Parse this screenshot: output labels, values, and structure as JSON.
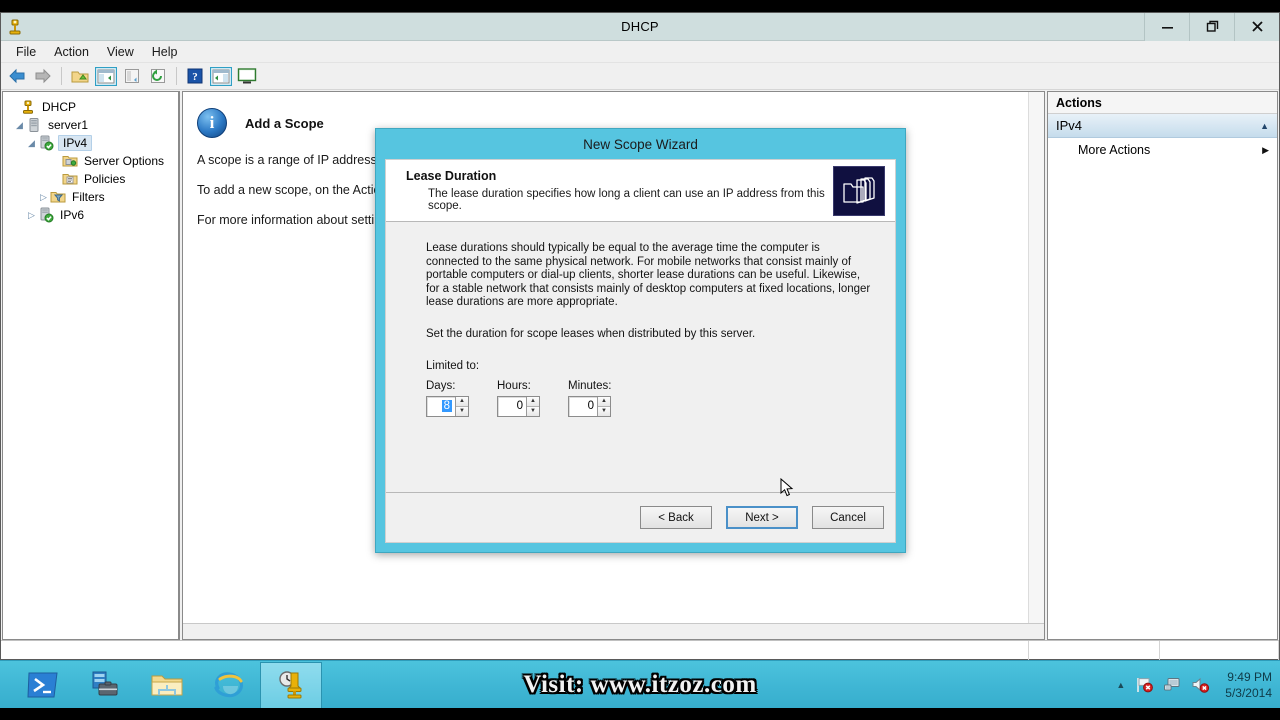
{
  "window": {
    "title": "DHCP",
    "icon": "dhcp-icon",
    "controls": {
      "minimize": "–",
      "restore": "❐",
      "close": "✕"
    }
  },
  "menubar": {
    "items": [
      "File",
      "Action",
      "View",
      "Help"
    ]
  },
  "toolbar": {
    "buttons": [
      {
        "name": "back-icon"
      },
      {
        "name": "forward-icon"
      },
      {
        "name": "up-folder-icon"
      },
      {
        "name": "show-hide-console-tree-icon"
      },
      {
        "name": "properties-icon"
      },
      {
        "name": "refresh-icon"
      },
      {
        "name": "help-icon"
      },
      {
        "name": "show-hide-action-pane-icon"
      },
      {
        "name": "export-list-icon"
      }
    ]
  },
  "tree": {
    "nodes": [
      {
        "label": "DHCP",
        "indent": 0,
        "expander": "",
        "icon": "dhcp-root-icon",
        "selected": false
      },
      {
        "label": "server1",
        "indent": 1,
        "expander": "◢",
        "icon": "server-icon",
        "selected": false
      },
      {
        "label": "IPv4",
        "indent": 2,
        "expander": "◢",
        "icon": "ipv4-ok-icon",
        "selected": true
      },
      {
        "label": "Server Options",
        "indent": 4,
        "expander": "",
        "icon": "server-options-folder-icon",
        "selected": false
      },
      {
        "label": "Policies",
        "indent": 4,
        "expander": "",
        "icon": "policies-folder-icon",
        "selected": false
      },
      {
        "label": "Filters",
        "indent": 3,
        "expander": "▷",
        "icon": "filters-folder-icon",
        "selected": false
      },
      {
        "label": "IPv6",
        "indent": 2,
        "expander": "▷",
        "icon": "ipv6-ok-icon",
        "selected": false
      }
    ]
  },
  "center": {
    "icon": "info-icon",
    "heading": "Add a Scope",
    "paragraphs": [
      "A scope is a range of IP addresses                                                                      ore dynamic IP addresses can be assigned.",
      "To add a new scope, on the Actio",
      "For more information about settin"
    ]
  },
  "actions": {
    "header": "Actions",
    "group": {
      "label": "IPv4",
      "collapse_icon": "chevron-up-icon"
    },
    "items": [
      {
        "label": "More Actions",
        "submenu_icon": "chevron-right-icon"
      }
    ]
  },
  "wizard": {
    "title": "New Scope Wizard",
    "header": {
      "title": "Lease Duration",
      "subtitle": "The lease duration specifies how long a client can use an IP address from this scope.",
      "icon": "folders-banner-icon"
    },
    "body": {
      "paragraph1": "Lease durations should typically be equal to the average time the computer is connected to the same physical network. For mobile networks that consist mainly of portable computers or dial-up clients, shorter lease durations can be useful. Likewise, for a stable network that consists mainly of desktop computers at fixed locations, longer lease durations are more appropriate.",
      "paragraph2": "Set the duration for scope leases when distributed by this server.",
      "limited_label": "Limited to:",
      "fields": [
        {
          "label": "Days:",
          "value": "8",
          "selected": true
        },
        {
          "label": "Hours:",
          "value": "0",
          "selected": false
        },
        {
          "label": "Minutes:",
          "value": "0",
          "selected": false
        }
      ]
    },
    "buttons": [
      {
        "label": "< Back",
        "name": "back-button",
        "default": false
      },
      {
        "label": "Next >",
        "name": "next-button",
        "default": true
      },
      {
        "label": "Cancel",
        "name": "cancel-button",
        "default": false
      }
    ]
  },
  "taskbar": {
    "apps": [
      {
        "name": "powershell-icon",
        "active": false
      },
      {
        "name": "server-manager-icon",
        "active": false
      },
      {
        "name": "file-explorer-icon",
        "active": false
      },
      {
        "name": "internet-explorer-icon",
        "active": false
      },
      {
        "name": "dhcp-taskbar-icon",
        "active": true
      }
    ],
    "watermark": "Visit: www.itzoz.com",
    "tray": {
      "show_hidden_icon": "chevron-up-icon",
      "icons": [
        "flag-error-icon",
        "network-icon",
        "volume-muted-icon"
      ],
      "time": "9:49 PM",
      "date": "5/3/2014"
    }
  },
  "colors": {
    "wizard_frame": "#56c5e0",
    "taskbar": "#4cc3dd",
    "selection_blue": "#3399ff",
    "actions_group": "#c5dcec"
  }
}
